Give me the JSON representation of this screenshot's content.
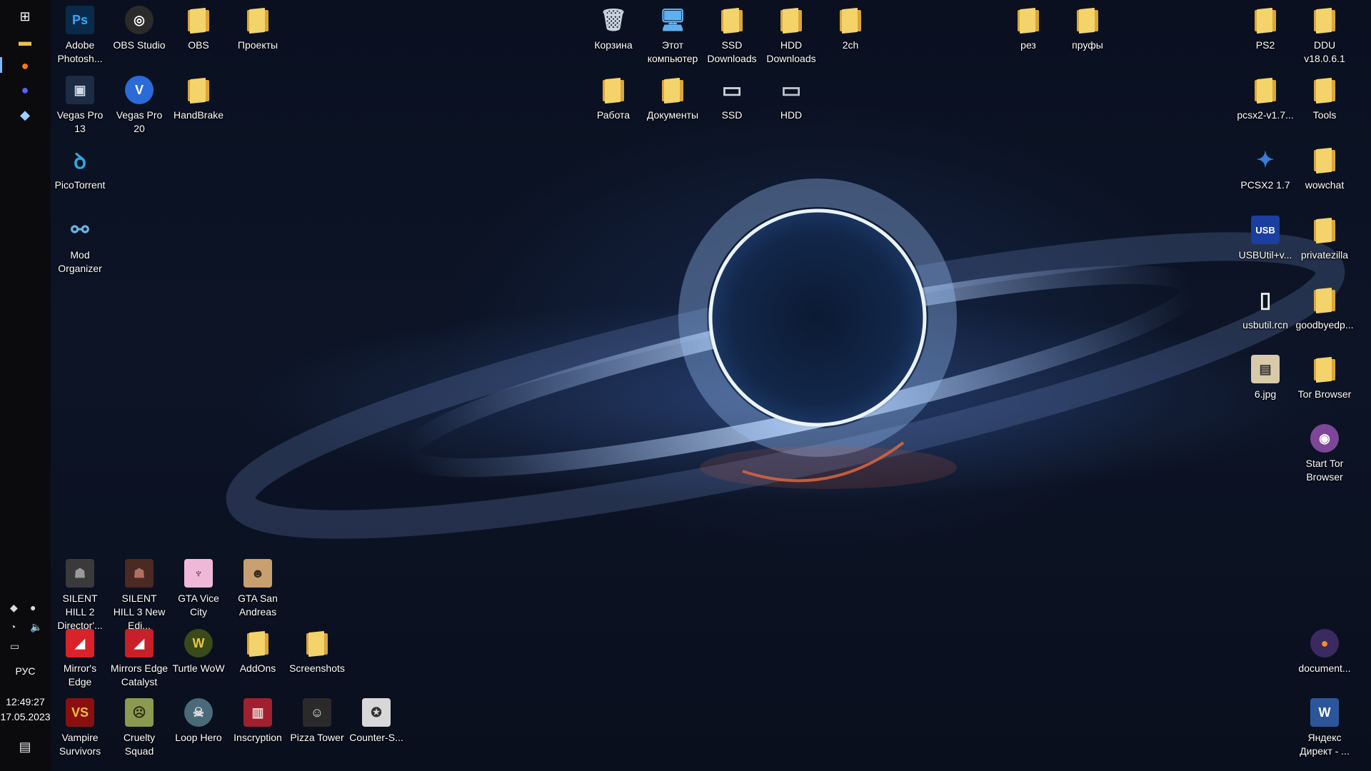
{
  "taskbar": {
    "pinned": [
      {
        "name": "windows-start-icon",
        "glyph": "⊞",
        "color": "#ffffff"
      },
      {
        "name": "file-explorer-icon",
        "glyph": "▬",
        "color": "#f1c04b"
      },
      {
        "name": "firefox-icon",
        "glyph": "●",
        "color": "#ff7a1a"
      },
      {
        "name": "discord-icon",
        "glyph": "●",
        "color": "#5865f2"
      },
      {
        "name": "steam-icon",
        "glyph": "◆",
        "color": "#9fd0ff"
      }
    ],
    "tray": {
      "language": "РУС",
      "time": "12:49:27",
      "date": "17.05.2023"
    }
  },
  "icons": [
    {
      "id": "photoshop",
      "label": "Adobe Photosh...",
      "icon": "photoshop-icon",
      "kind": "tile",
      "text": "Ps",
      "bg": "#0a2a4a",
      "fg": "#31a8ff",
      "col": "L1",
      "row": 1
    },
    {
      "id": "obs-studio",
      "label": "OBS Studio",
      "icon": "obs-studio-icon",
      "kind": "circle",
      "text": "◎",
      "bg": "#2b2b2b",
      "fg": "#ffffff",
      "col": "L2",
      "row": 1
    },
    {
      "id": "obs",
      "label": "OBS",
      "icon": "obs-folder-icon",
      "kind": "folder",
      "col": "L3",
      "row": 1
    },
    {
      "id": "proekty",
      "label": "Проекты",
      "icon": "folder-icon",
      "kind": "folder",
      "col": "L4",
      "row": 1
    },
    {
      "id": "vegas13",
      "label": "Vegas Pro 13",
      "icon": "vegas-pro-13-icon",
      "kind": "tile",
      "text": "▣",
      "bg": "#1d2b44",
      "fg": "#cfd8e6",
      "col": "L1",
      "row": 2
    },
    {
      "id": "vegas20",
      "label": "Vegas Pro 20",
      "icon": "vegas-pro-20-icon",
      "kind": "circle",
      "text": "V",
      "bg": "#2a6bd8",
      "fg": "#ffffff",
      "col": "L2",
      "row": 2
    },
    {
      "id": "handbrake",
      "label": "HandBrake",
      "icon": "handbrake-icon",
      "kind": "folder",
      "col": "L3",
      "row": 2
    },
    {
      "id": "picotorrent",
      "label": "PicoTorrent",
      "icon": "picotorrent-icon",
      "kind": "glyph",
      "text": "ꝺ",
      "bg": "transparent",
      "fg": "#2fa8e0",
      "col": "L1",
      "row": 3
    },
    {
      "id": "modorganizer",
      "label": "Mod Organizer",
      "icon": "mod-organizer-icon",
      "kind": "glyph",
      "text": "⚯",
      "bg": "transparent",
      "fg": "#6ab2e0",
      "col": "L1",
      "row": 4
    },
    {
      "id": "recycle",
      "label": "Корзина",
      "icon": "recycle-bin-icon",
      "kind": "glyph",
      "text": "🗑",
      "bg": "transparent",
      "fg": "#c9d3dd",
      "col": "C1",
      "row": 1
    },
    {
      "id": "thispc",
      "label": "Этот компьютер",
      "icon": "this-pc-icon",
      "kind": "glyph",
      "text": "🖥",
      "bg": "transparent",
      "fg": "#5fb0f0",
      "col": "C2",
      "row": 1
    },
    {
      "id": "ssddl",
      "label": "SSD Downloads",
      "icon": "downloads-folder-icon",
      "kind": "folder",
      "col": "C3",
      "row": 1
    },
    {
      "id": "hdddl",
      "label": "HDD Downloads",
      "icon": "downloads-folder-icon",
      "kind": "folder",
      "col": "C4",
      "row": 1
    },
    {
      "id": "2ch",
      "label": "2ch",
      "icon": "folder-icon",
      "kind": "folder",
      "col": "C5",
      "row": 1
    },
    {
      "id": "rabota",
      "label": "Работа",
      "icon": "folder-icon",
      "kind": "folder",
      "col": "C1",
      "row": 2
    },
    {
      "id": "docs",
      "label": "Документы",
      "icon": "documents-folder-icon",
      "kind": "folder",
      "col": "C2",
      "row": 2
    },
    {
      "id": "ssd",
      "label": "SSD",
      "icon": "drive-icon",
      "kind": "glyph",
      "text": "▭",
      "bg": "transparent",
      "fg": "#cfd6dd",
      "col": "C3",
      "row": 2
    },
    {
      "id": "hdd",
      "label": "HDD",
      "icon": "drive-icon",
      "kind": "glyph",
      "text": "▭",
      "bg": "transparent",
      "fg": "#bfc6cc",
      "col": "C4",
      "row": 2
    },
    {
      "id": "rez",
      "label": "рез",
      "icon": "folder-icon",
      "kind": "folder",
      "col": "R0a",
      "row": 1
    },
    {
      "id": "prufy",
      "label": "пруфы",
      "icon": "folder-icon",
      "kind": "folder",
      "col": "R0b",
      "row": 1
    },
    {
      "id": "ps2",
      "label": "PS2",
      "icon": "folder-icon",
      "kind": "folder",
      "col": "R1",
      "row": 1
    },
    {
      "id": "ddu",
      "label": "DDU v18.0.6.1",
      "icon": "folder-icon",
      "kind": "folder",
      "col": "R2",
      "row": 1
    },
    {
      "id": "pcsx2folder",
      "label": "pcsx2-v1.7...",
      "icon": "folder-icon",
      "kind": "folder",
      "col": "R1",
      "row": 2
    },
    {
      "id": "tools",
      "label": "Tools",
      "icon": "folder-icon",
      "kind": "folder",
      "col": "R2",
      "row": 2
    },
    {
      "id": "pcsx2",
      "label": "PCSX2 1.7",
      "icon": "pcsx2-icon",
      "kind": "glyph",
      "text": "✦",
      "bg": "transparent",
      "fg": "#3a7bd5",
      "col": "R1",
      "row": 3
    },
    {
      "id": "wowchat",
      "label": "wowchat",
      "icon": "folder-icon",
      "kind": "folder",
      "col": "R2",
      "row": 3
    },
    {
      "id": "usbutil",
      "label": "USBUtil+v...",
      "icon": "usbutil-icon",
      "kind": "tile",
      "text": "USB",
      "bg": "#1b3fa0",
      "fg": "#ffffff",
      "col": "R1",
      "row": 4
    },
    {
      "id": "privatezilla",
      "label": "privatezilla",
      "icon": "folder-icon",
      "kind": "folder",
      "col": "R2",
      "row": 4
    },
    {
      "id": "usbutilrcn",
      "label": "usbutil.rcn",
      "icon": "file-icon",
      "kind": "glyph",
      "text": "▯",
      "bg": "transparent",
      "fg": "#f2f2f2",
      "col": "R1",
      "row": 5
    },
    {
      "id": "goodbyedp",
      "label": "goodbyedp...",
      "icon": "folder-icon",
      "kind": "folder",
      "col": "R2",
      "row": 5
    },
    {
      "id": "6jpg",
      "label": "6.jpg",
      "icon": "image-file-icon",
      "kind": "tile",
      "text": "▤",
      "bg": "#d8c9a8",
      "fg": "#333333",
      "col": "R1",
      "row": 6
    },
    {
      "id": "torbrowser",
      "label": "Tor Browser",
      "icon": "folder-icon",
      "kind": "folder",
      "col": "R2",
      "row": 6
    },
    {
      "id": "starttor",
      "label": "Start Tor Browser",
      "icon": "tor-browser-icon",
      "kind": "circle",
      "text": "◉",
      "bg": "#7d4698",
      "fg": "#ffffff",
      "col": "R2",
      "row": 7
    },
    {
      "id": "document",
      "label": "document...",
      "icon": "firefox-document-icon",
      "kind": "circle",
      "text": "●",
      "bg": "#3a2a60",
      "fg": "#ff8a2a",
      "col": "R2",
      "row": 10
    },
    {
      "id": "yandex",
      "label": "Яндекс Директ - ...",
      "icon": "word-document-icon",
      "kind": "tile",
      "text": "W",
      "bg": "#2b579a",
      "fg": "#ffffff",
      "col": "R2",
      "row": 11
    },
    {
      "id": "sh2",
      "label": "SILENT HILL 2 Director'...",
      "icon": "silent-hill-2-icon",
      "kind": "tile",
      "text": "☗",
      "bg": "#3a3a3a",
      "fg": "#9a9a9a",
      "col": "L1",
      "row": 9
    },
    {
      "id": "sh3",
      "label": "SILENT HILL 3 New Edi...",
      "icon": "silent-hill-3-icon",
      "kind": "tile",
      "text": "☗",
      "bg": "#4a2a22",
      "fg": "#b07060",
      "col": "L2",
      "row": 9
    },
    {
      "id": "gtavc",
      "label": "GTA Vice City",
      "icon": "gta-vice-city-icon",
      "kind": "tile",
      "text": "♆",
      "bg": "#f0b8d8",
      "fg": "#6a2050",
      "col": "L3",
      "row": 9
    },
    {
      "id": "gtasa",
      "label": "GTA San Andreas",
      "icon": "gta-san-andreas-icon",
      "kind": "tile",
      "text": "☻",
      "bg": "#c8a070",
      "fg": "#3a2a1a",
      "col": "L4",
      "row": 9
    },
    {
      "id": "mirrors",
      "label": "Mirror's Edge",
      "icon": "mirrors-edge-icon",
      "kind": "tile",
      "text": "◢",
      "bg": "#d8232a",
      "fg": "#ffffff",
      "col": "L1",
      "row": 10
    },
    {
      "id": "mirrorscat",
      "label": "Mirrors Edge Catalyst",
      "icon": "mirrors-edge-catalyst-icon",
      "kind": "tile",
      "text": "◢",
      "bg": "#c82028",
      "fg": "#ffffff",
      "col": "L2",
      "row": 10
    },
    {
      "id": "turtlewow",
      "label": "Turtle WoW",
      "icon": "world-of-warcraft-icon",
      "kind": "circle",
      "text": "W",
      "bg": "#3a4a18",
      "fg": "#e8c848",
      "col": "L3",
      "row": 10
    },
    {
      "id": "addons",
      "label": "AddOns",
      "icon": "folder-icon",
      "kind": "folder",
      "col": "L4",
      "row": 10
    },
    {
      "id": "screenshots",
      "label": "Screenshots",
      "icon": "folder-icon",
      "kind": "folder",
      "col": "L5",
      "row": 10
    },
    {
      "id": "vampire",
      "label": "Vampire Survivors",
      "icon": "vampire-survivors-icon",
      "kind": "tile",
      "text": "VS",
      "bg": "#8a1010",
      "fg": "#f0c040",
      "col": "L1",
      "row": 11
    },
    {
      "id": "cruelty",
      "label": "Cruelty Squad",
      "icon": "cruelty-squad-icon",
      "kind": "tile",
      "text": "☹",
      "bg": "#8a9a50",
      "fg": "#2a2a10",
      "col": "L2",
      "row": 11
    },
    {
      "id": "loophero",
      "label": "Loop Hero",
      "icon": "loop-hero-icon",
      "kind": "circle",
      "text": "☠",
      "bg": "#4a6a7a",
      "fg": "#e0e0e0",
      "col": "L3",
      "row": 11
    },
    {
      "id": "inscryption",
      "label": "Inscryption",
      "icon": "inscryption-icon",
      "kind": "tile",
      "text": "▥",
      "bg": "#a02030",
      "fg": "#f0d8d0",
      "col": "L4",
      "row": 11
    },
    {
      "id": "pizzatower",
      "label": "Pizza Tower",
      "icon": "pizza-tower-icon",
      "kind": "tile",
      "text": "☺",
      "bg": "#2a2a2a",
      "fg": "#e8e8e8",
      "col": "L5",
      "row": 11
    },
    {
      "id": "counterstrike",
      "label": "Counter-S...",
      "icon": "counter-strike-icon",
      "kind": "tile",
      "text": "✪",
      "bg": "#d8d8d8",
      "fg": "#303030",
      "col": "L6",
      "row": 11
    }
  ]
}
